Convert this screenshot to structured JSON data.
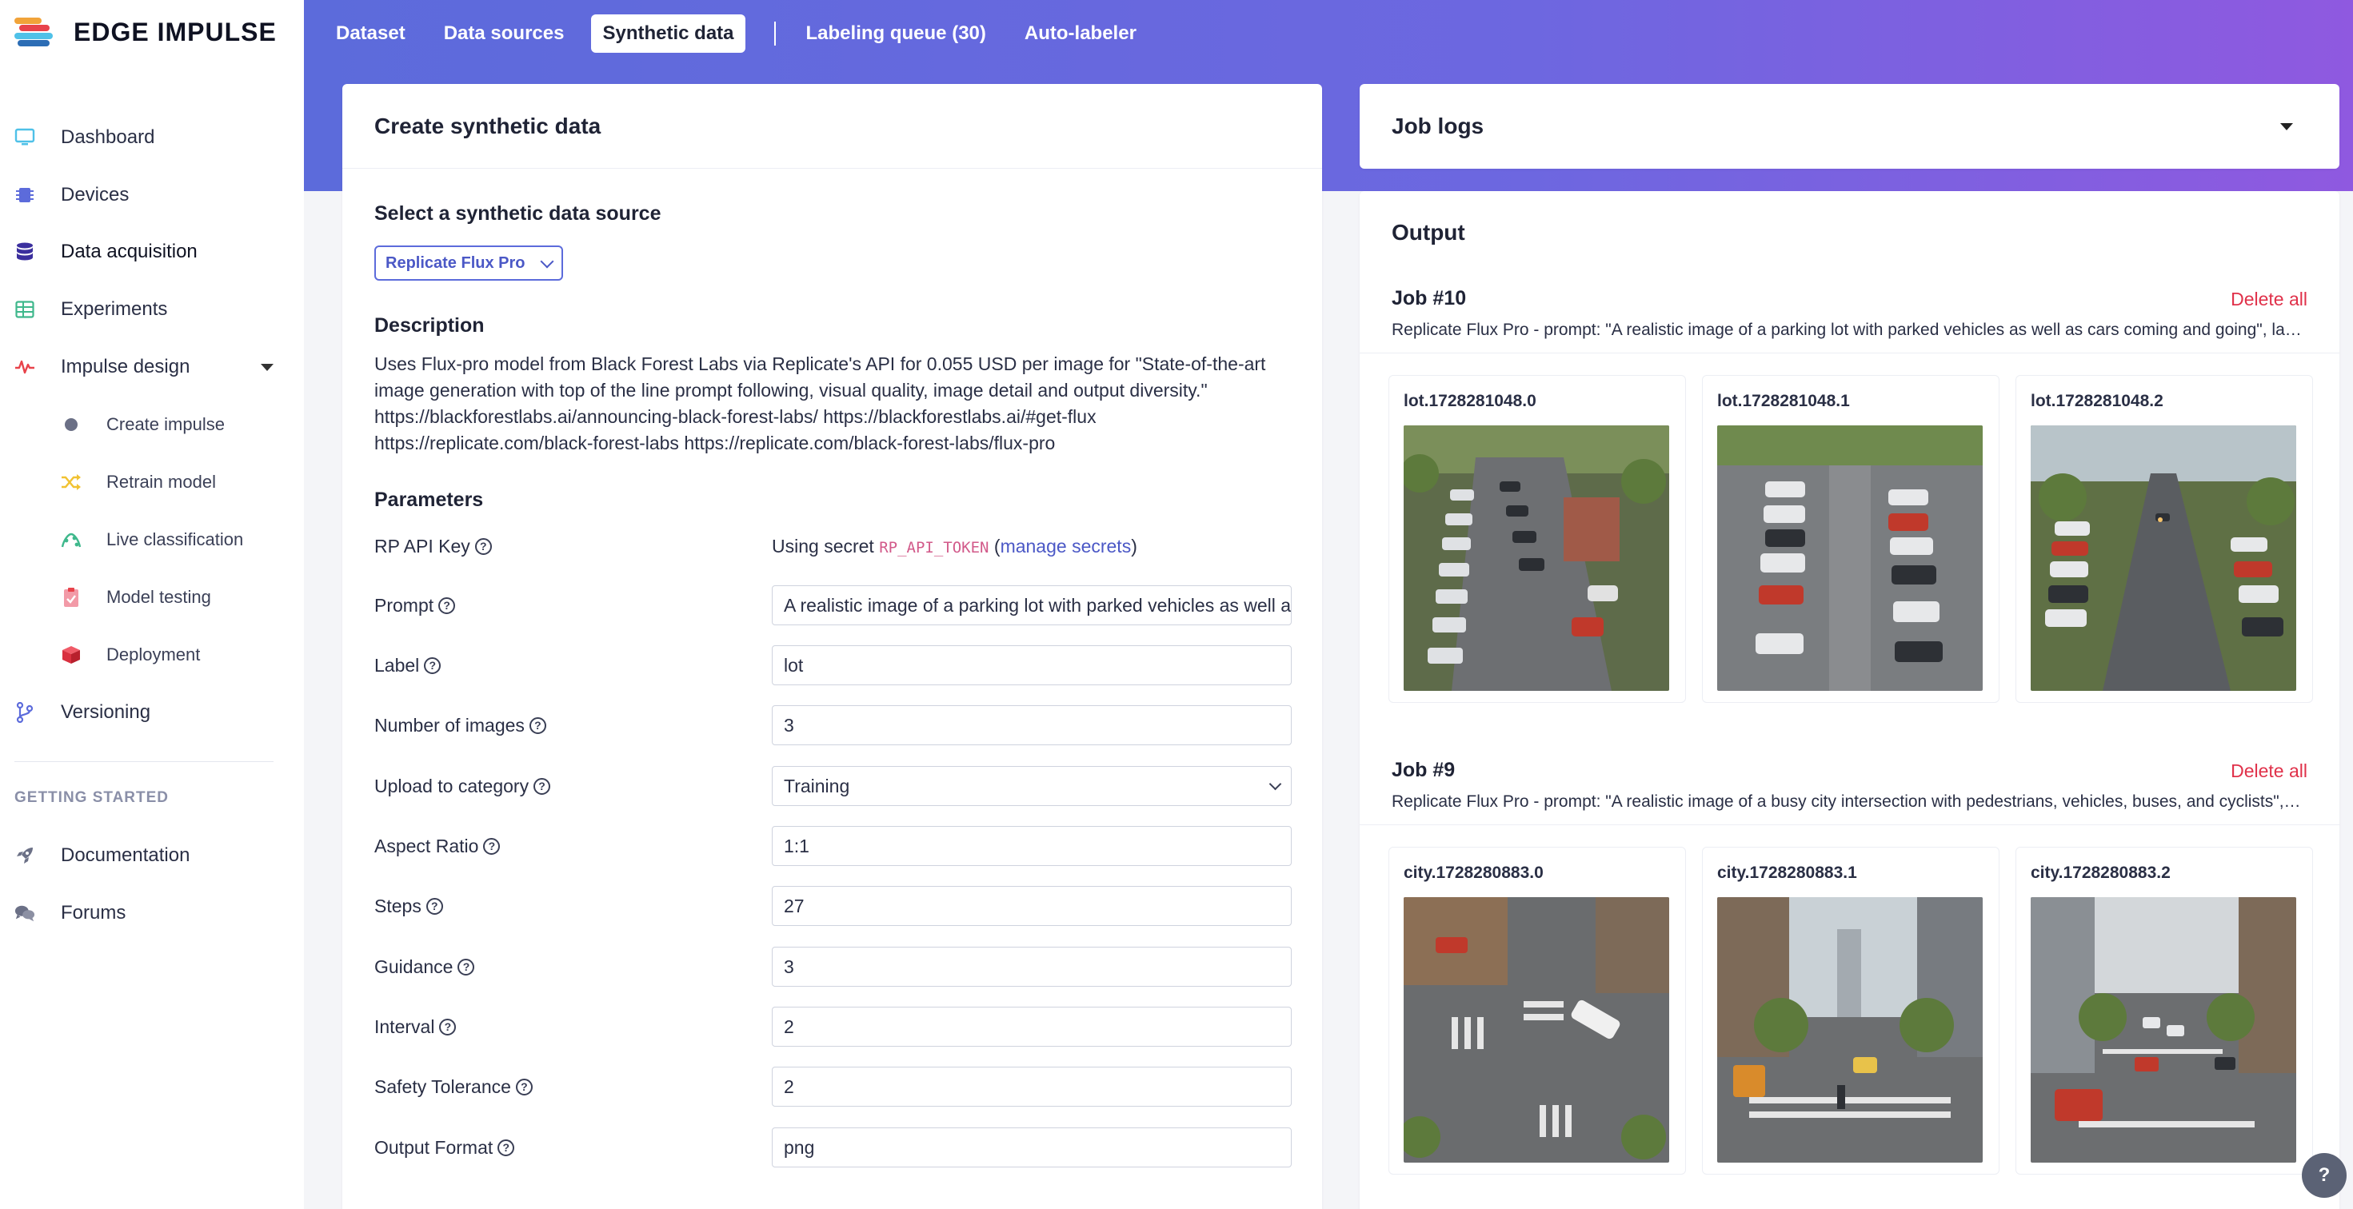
{
  "brand": {
    "name": "EDGE IMPULSE",
    "colors": [
      "#f1a33a",
      "#e8434b",
      "#4fc1e8",
      "#2c6db5"
    ]
  },
  "sidebar": {
    "items": [
      {
        "label": "Dashboard",
        "icon": "monitor-icon"
      },
      {
        "label": "Devices",
        "icon": "chip-icon"
      },
      {
        "label": "Data acquisition",
        "icon": "database-icon",
        "active": true
      },
      {
        "label": "Experiments",
        "icon": "table-icon"
      },
      {
        "label": "Impulse design",
        "icon": "pulse-icon",
        "expanded": true
      },
      {
        "label": "Create impulse",
        "icon": "dot-icon",
        "sub": true
      },
      {
        "label": "Retrain model",
        "icon": "shuffle-icon",
        "sub": true
      },
      {
        "label": "Live classification",
        "icon": "radar-icon",
        "sub": true
      },
      {
        "label": "Model testing",
        "icon": "clipboard-icon",
        "sub": true
      },
      {
        "label": "Deployment",
        "icon": "cube-icon",
        "sub": true
      },
      {
        "label": "Versioning",
        "icon": "branch-icon"
      }
    ],
    "section_label": "GETTING STARTED",
    "bottom_items": [
      {
        "label": "Documentation",
        "icon": "rocket-icon"
      },
      {
        "label": "Forums",
        "icon": "chat-icon"
      }
    ]
  },
  "tabs": [
    {
      "label": "Dataset"
    },
    {
      "label": "Data sources"
    },
    {
      "label": "Synthetic data",
      "active": true
    },
    {
      "label": "Labeling queue (30)"
    },
    {
      "label": "Auto-labeler"
    }
  ],
  "create": {
    "title": "Create synthetic data",
    "source_heading": "Select a synthetic data source",
    "source_selected": "Replicate Flux Pro",
    "description_heading": "Description",
    "description": "Uses Flux-pro model from Black Forest Labs via Replicate's API for 0.055 USD per image for \"State-of-the-art image generation with top of the line prompt following, visual quality, image detail and output diversity.\" https://blackforestlabs.ai/announcing-black-forest-labs/ https://blackforestlabs.ai/#get-flux https://replicate.com/black-forest-labs https://replicate.com/black-forest-labs/flux-pro",
    "parameters_heading": "Parameters",
    "api_key": {
      "label": "RP API Key",
      "prefix": "Using secret ",
      "secret": "RP_API_TOKEN",
      "paren_open": " (",
      "link": "manage secrets",
      "paren_close": ")"
    },
    "params": [
      {
        "label": "Prompt",
        "value": "A realistic image of a parking lot with parked vehicles as well as cars coming and going"
      },
      {
        "label": "Label",
        "value": "lot"
      },
      {
        "label": "Number of images",
        "value": "3"
      },
      {
        "label": "Upload to category",
        "value": "Training",
        "type": "select"
      },
      {
        "label": "Aspect Ratio",
        "value": "1:1"
      },
      {
        "label": "Steps",
        "value": "27"
      },
      {
        "label": "Guidance",
        "value": "3"
      },
      {
        "label": "Interval",
        "value": "2"
      },
      {
        "label": "Safety Tolerance",
        "value": "2"
      },
      {
        "label": "Output Format",
        "value": "png"
      }
    ]
  },
  "job_logs": {
    "title": "Job logs"
  },
  "output": {
    "title": "Output",
    "jobs": [
      {
        "title": "Job #10",
        "delete_label": "Delete all",
        "description": "Replicate Flux Pro - prompt: \"A realistic image of a parking lot with parked vehicles as well as cars coming and going\", label: \"lot\"",
        "images": [
          "lot.1728281048.0",
          "lot.1728281048.1",
          "lot.1728281048.2"
        ]
      },
      {
        "title": "Job #9",
        "delete_label": "Delete all",
        "description": "Replicate Flux Pro - prompt: \"A realistic image of a busy city intersection with pedestrians, vehicles, buses, and cyclists\", label: \"city\"",
        "images": [
          "city.1728280883.0",
          "city.1728280883.1",
          "city.1728280883.2"
        ]
      }
    ]
  },
  "help_fab": "?"
}
